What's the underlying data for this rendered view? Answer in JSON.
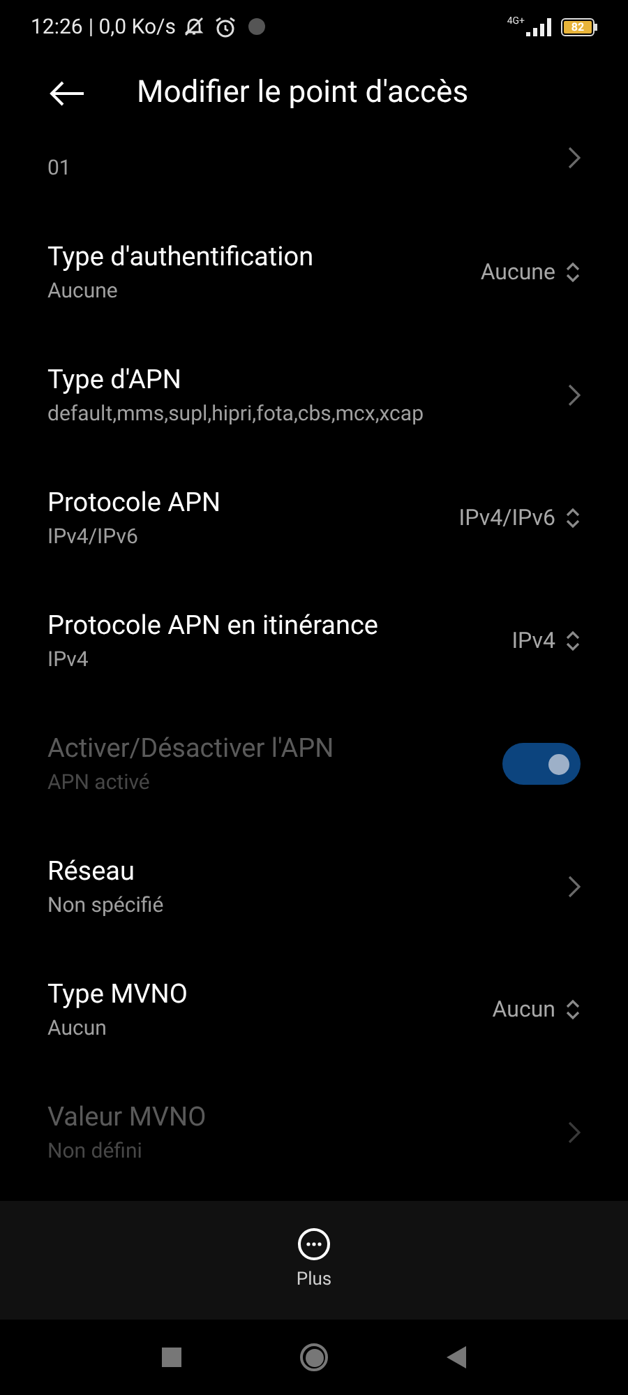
{
  "status_bar": {
    "time": "12:26",
    "speed": "| 0,0 Ko/s",
    "network": "4G+",
    "battery": "82"
  },
  "header": {
    "title": "Modifier le point d'accès"
  },
  "partial_row": {
    "subtitle": "01"
  },
  "rows": [
    {
      "kind": "select",
      "title": "Type d'authentification",
      "subtitle": "Aucune",
      "value": "Aucune",
      "disabled": false
    },
    {
      "kind": "chevron",
      "title": "Type d'APN",
      "subtitle": "default,mms,supl,hipri,fota,cbs,mcx,xcap",
      "disabled": false
    },
    {
      "kind": "select",
      "title": "Protocole APN",
      "subtitle": "IPv4/IPv6",
      "value": "IPv4/IPv6",
      "disabled": false
    },
    {
      "kind": "select",
      "title": "Protocole APN en itinérance",
      "subtitle": "IPv4",
      "value": "IPv4",
      "disabled": false
    },
    {
      "kind": "toggle",
      "title": "Activer/Désactiver l'APN",
      "subtitle": "APN activé",
      "on": true,
      "disabled": true
    },
    {
      "kind": "chevron",
      "title": "Réseau",
      "subtitle": "Non spécifié",
      "disabled": false
    },
    {
      "kind": "select",
      "title": "Type MVNO",
      "subtitle": "Aucun",
      "value": "Aucun",
      "disabled": false
    },
    {
      "kind": "chevron",
      "title": "Valeur MVNO",
      "subtitle": "Non défini",
      "disabled": true
    }
  ],
  "bottom_action": {
    "label": "Plus"
  }
}
